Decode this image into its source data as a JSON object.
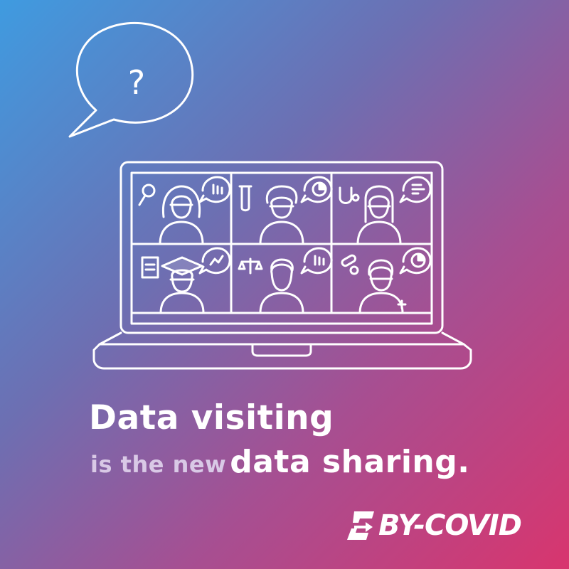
{
  "headline": "Data visiting",
  "subline": {
    "prefix": "is the new",
    "emphasis": "data sharing."
  },
  "logo": {
    "text": "BY-COVID",
    "icon": "logo-e-arrow-icon"
  },
  "speech_bubble": {
    "symbol": "?",
    "icon": "speech-bubble-icon"
  },
  "video_call_tiles": [
    {
      "icon": "magnifier-icon",
      "bubble": "bar-chart-icon"
    },
    {
      "icon": "test-tube-icon",
      "bubble": "pie-chart-icon"
    },
    {
      "icon": "stethoscope-icon",
      "bubble": "list-chart-icon"
    },
    {
      "icon": "clipboard-icon",
      "bubble": "line-chart-icon"
    },
    {
      "icon": "scales-icon",
      "bubble": "bar-chart-icon"
    },
    {
      "icon": "pills-icon",
      "bubble": "pie-chart-icon"
    }
  ],
  "colors": {
    "gradient_start": "#3f9be0",
    "gradient_mid": "#a64f92",
    "gradient_end": "#d8356e",
    "text": "#ffffff",
    "muted_text": "#d9c9e6"
  }
}
